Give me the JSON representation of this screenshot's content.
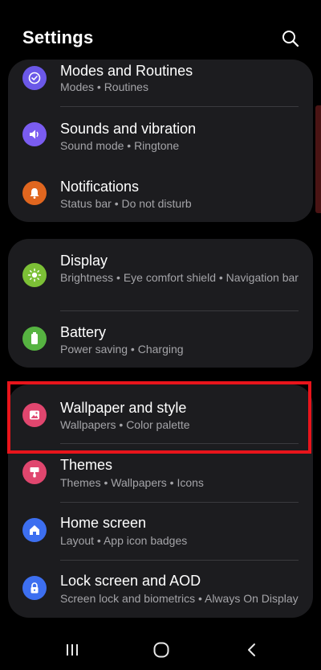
{
  "header": {
    "title": "Settings",
    "search_icon": "search-icon"
  },
  "groups": [
    {
      "items": [
        {
          "title": "Modes and Routines",
          "subtitle": "Modes  •  Routines",
          "icon": "modes-routines-icon",
          "color": "#6b58e8"
        },
        {
          "title": "Sounds and vibration",
          "subtitle": "Sound mode  •  Ringtone",
          "icon": "speaker-icon",
          "color": "#7a5cf0"
        },
        {
          "title": "Notifications",
          "subtitle": "Status bar  •  Do not disturb",
          "icon": "bell-icon",
          "color": "#e0661f"
        }
      ]
    },
    {
      "items": [
        {
          "title": "Display",
          "subtitle": "Brightness  •  Eye comfort shield  •  Navigation bar",
          "icon": "sun-icon",
          "color": "#7cc036"
        },
        {
          "title": "Battery",
          "subtitle": "Power saving  •  Charging",
          "icon": "battery-icon",
          "color": "#56b341"
        }
      ]
    },
    {
      "items": [
        {
          "title": "Wallpaper and style",
          "subtitle": "Wallpapers  •  Color palette",
          "icon": "wallpaper-icon",
          "color": "#e0466e"
        },
        {
          "title": "Themes",
          "subtitle": "Themes  •  Wallpapers  •  Icons",
          "icon": "themes-brush-icon",
          "color": "#e0466e"
        },
        {
          "title": "Home screen",
          "subtitle": "Layout  •  App icon badges",
          "icon": "home-icon",
          "color": "#3d6ff0"
        },
        {
          "title": "Lock screen and AOD",
          "subtitle": "Screen lock and biometrics  •  Always On Display",
          "icon": "lock-icon",
          "color": "#3d6ff0"
        }
      ]
    }
  ],
  "highlight_color": "#e8141b",
  "navbar": {
    "recents": "recents-icon",
    "home": "home-button-icon",
    "back": "back-icon"
  }
}
